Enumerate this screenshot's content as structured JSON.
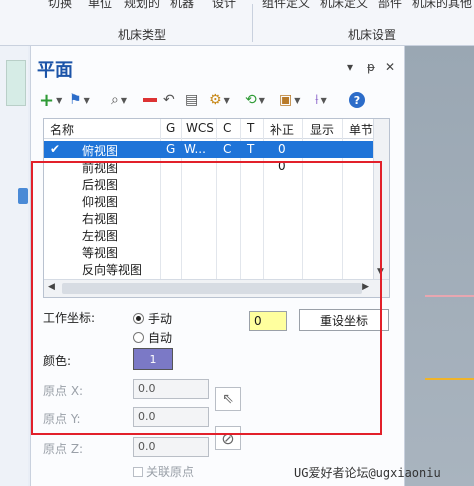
{
  "ribbon": {
    "clipped_labels": [
      "切换",
      "单位",
      "规划的",
      "机器",
      "设计",
      "组件定义",
      "机床定义",
      "部件",
      "机床的其他"
    ],
    "group_machine_type": "机床类型",
    "group_machine_settings": "机床设置"
  },
  "panel": {
    "title": "平面",
    "menu_glyph": "▾",
    "pin_glyph": "ᵽ",
    "close_glyph": "✕"
  },
  "toolbar": {
    "icons": [
      "add-icon",
      "flag-icon",
      "zoom-icon",
      "line-icon",
      "undo-icon",
      "sheet-icon",
      "gear-icon",
      "refresh-icon",
      "box-icon",
      "axis-icon",
      "help-icon"
    ]
  },
  "grid": {
    "columns": [
      "名称",
      "G",
      "WCS",
      "C",
      "T",
      "补正",
      "显示",
      "单节"
    ],
    "rows": [
      {
        "check": "✔",
        "name": "俯视图",
        "g": "G",
        "wcs": "W...",
        "c": "C",
        "t": "T",
        "offset": "0"
      },
      {
        "check": "",
        "name": "前视图",
        "g": "",
        "wcs": "",
        "c": "",
        "t": "",
        "offset": "0"
      },
      {
        "check": "",
        "name": "后视图",
        "g": "",
        "wcs": "",
        "c": "",
        "t": "",
        "offset": ""
      },
      {
        "check": "",
        "name": "仰视图",
        "g": "",
        "wcs": "",
        "c": "",
        "t": "",
        "offset": ""
      },
      {
        "check": "",
        "name": "右视图",
        "g": "",
        "wcs": "",
        "c": "",
        "t": "",
        "offset": ""
      },
      {
        "check": "",
        "name": "左视图",
        "g": "",
        "wcs": "",
        "c": "",
        "t": "",
        "offset": ""
      },
      {
        "check": "",
        "name": "等视图",
        "g": "",
        "wcs": "",
        "c": "",
        "t": "",
        "offset": ""
      },
      {
        "check": "",
        "name": "反向等视图",
        "g": "",
        "wcs": "",
        "c": "",
        "t": "",
        "offset": ""
      }
    ]
  },
  "form": {
    "work_coord_label": "工作坐标:",
    "radio_manual": "手动",
    "radio_auto": "自动",
    "work_coord_value": "0",
    "reset_button": "重设坐标",
    "color_label": "颜色:",
    "color_value": "1",
    "color_hex": "#7b79c6",
    "origin_x_label": "原点 X:",
    "origin_x_value": "0.0",
    "origin_y_label": "原点 Y:",
    "origin_y_value": "0.0",
    "origin_z_label": "原点 Z:",
    "origin_z_value": "0.0",
    "link_origin_label": "关联原点"
  },
  "watermark": "UG爱好者论坛@ugxiaoniu"
}
